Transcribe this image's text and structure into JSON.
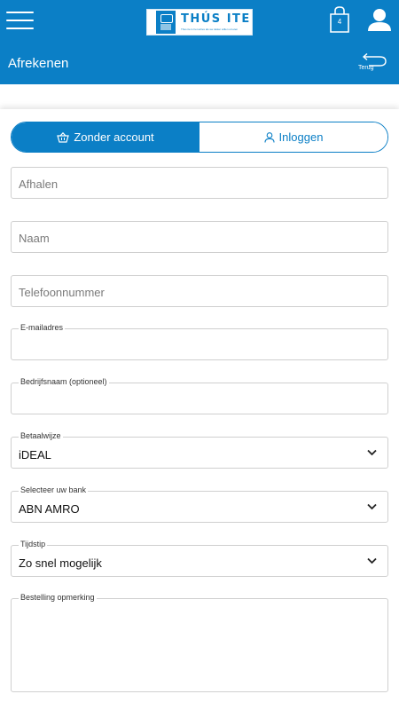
{
  "header": {
    "logo_name": "THÚS ITE",
    "logo_tagline": "Thus ite is het adres als we lekker willen uit eten",
    "cart_count": "4"
  },
  "subheader": {
    "title": "Afrekenen",
    "back_label": "Terug"
  },
  "segment": {
    "guest_label": "Zonder account",
    "login_label": "Inloggen"
  },
  "form": {
    "delivery": {
      "placeholder": "Afhalen"
    },
    "name": {
      "placeholder": "Naam"
    },
    "phone": {
      "placeholder": "Telefoonnummer"
    },
    "email": {
      "label": "E-mailadres",
      "value": ""
    },
    "company": {
      "label": "Bedrijfsnaam (optioneel)",
      "value": ""
    },
    "payment": {
      "label": "Betaalwijze",
      "value": "iDEAL"
    },
    "bank": {
      "label": "Selecteer uw bank",
      "value": "ABN AMRO"
    },
    "time": {
      "label": "Tijdstip",
      "value": "Zo snel mogelijk"
    },
    "remark": {
      "label": "Bestelling opmerking",
      "value": ""
    }
  },
  "colors": {
    "brand": "#0b7fc6",
    "border": "#cfcfcf"
  },
  "icons": [
    "hamburger-menu-icon",
    "cart-icon",
    "user-icon",
    "back-arrow-icon",
    "basket-icon",
    "person-icon",
    "chevron-down-icon"
  ]
}
